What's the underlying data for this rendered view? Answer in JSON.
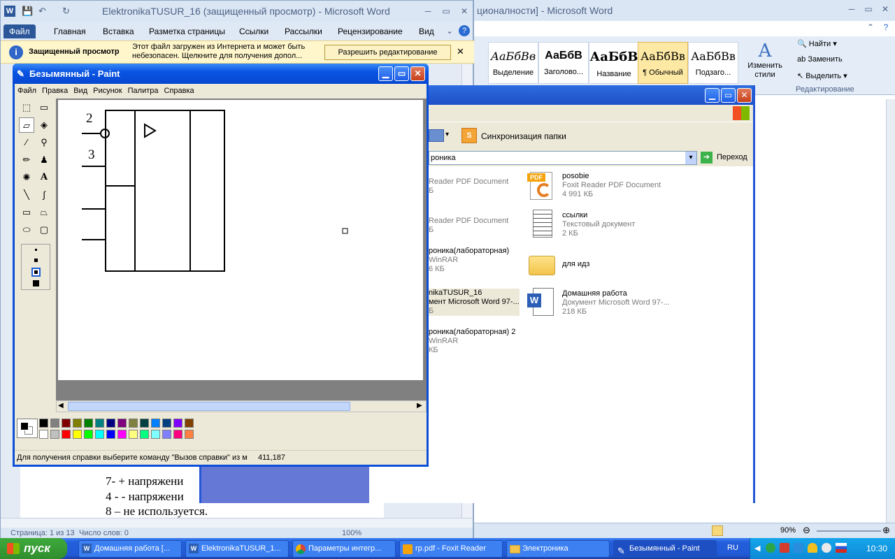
{
  "word_back": {
    "title": "ционалности] - Microsoft Word",
    "styles": [
      {
        "sample": "АаБбВв",
        "name": "Выделение"
      },
      {
        "sample": "АаБбВ",
        "name": "Заголово..."
      },
      {
        "sample": "АаБбВ",
        "name": "Название"
      },
      {
        "sample": "АаБбВв",
        "name": "¶ Обычный"
      },
      {
        "sample": "АаБбВв",
        "name": "Подзаго..."
      }
    ],
    "change_styles": "Изменить стили",
    "find": "Найти",
    "replace": "Заменить",
    "select": "Выделить",
    "editing_group": "Редактирование",
    "zoom": "90%"
  },
  "word_front": {
    "title": "ElektronikaTUSUR_16 (защищенный просмотр) - Microsoft Word",
    "tabs": [
      "Файл",
      "Главная",
      "Вставка",
      "Разметка страницы",
      "Ссылки",
      "Рассылки",
      "Рецензирование",
      "Вид"
    ],
    "protected_label": "Защищенный просмотр",
    "protected_text1": "Этот файл загружен из Интернета и может быть",
    "protected_text2": "небезопасен. Щелкните для получения допол...",
    "enable_editing": "Разрешить редактирование",
    "doc_lines": [
      "7-  + напряжени",
      "4 - - напряжени",
      "8 – не используется."
    ],
    "status_page": "Страница: 1 из 13",
    "status_words": "Число слов: 0",
    "zoom": "100%"
  },
  "explorer": {
    "sync_button": "Синхронизация папки",
    "address": "роника",
    "go_button": "Переход",
    "left_items": [
      {
        "name": "",
        "sub1": "Reader PDF Document",
        "sub2": "Б"
      },
      {
        "name": "",
        "sub1": "Reader PDF Document",
        "sub2": "Б"
      },
      {
        "name": "роника(лабораторная)",
        "sub1": "WinRAR",
        "sub2": "6 КБ"
      },
      {
        "name": "nikaTUSUR_16",
        "sub1": "мент Microsoft Word 97-...",
        "sub2": "Б"
      },
      {
        "name": "роника(лабораторная) 2",
        "sub1": "WinRAR",
        "sub2": "КБ"
      }
    ],
    "right_items": [
      {
        "name": "posobie",
        "sub1": "Foxit Reader PDF Document",
        "sub2": "4 991 КБ",
        "icon": "pdf-icon"
      },
      {
        "name": "ссылки",
        "sub1": "Текстовый документ",
        "sub2": "2 КБ",
        "icon": "text-document-icon"
      },
      {
        "name": "для идз",
        "sub1": "",
        "sub2": "",
        "icon": "folder-icon"
      },
      {
        "name": "Домашняя работа",
        "sub1": "Документ Microsoft Word 97-...",
        "sub2": "218 КБ",
        "icon": "word-document-icon"
      }
    ]
  },
  "paint": {
    "title": "Безымянный - Paint",
    "menu": [
      "Файл",
      "Правка",
      "Вид",
      "Рисунок",
      "Палитра",
      "Справка"
    ],
    "drawing_labels": [
      "2",
      "3"
    ],
    "status": "Для получения справки выберите команду \"Вызов справки\" из м",
    "coords": "411,187",
    "palette_top": [
      "#000000",
      "#808080",
      "#800000",
      "#808000",
      "#008000",
      "#008080",
      "#000080",
      "#800080",
      "#808040",
      "#004040",
      "#0080ff",
      "#004080",
      "#8000ff",
      "#804000"
    ],
    "palette_bottom": [
      "#ffffff",
      "#c0c0c0",
      "#ff0000",
      "#ffff00",
      "#00ff00",
      "#00ffff",
      "#0000ff",
      "#ff00ff",
      "#ffff80",
      "#00ff80",
      "#80ffff",
      "#8080ff",
      "#ff0080",
      "#ff8040"
    ]
  },
  "taskbar": {
    "start": "пуск",
    "tasks": [
      {
        "label": "Домашняя работа [...",
        "icon": "word-icon"
      },
      {
        "label": "ElektronikaTUSUR_1...",
        "icon": "word-icon"
      },
      {
        "label": "Параметры интегр...",
        "icon": "chrome-icon"
      },
      {
        "label": "rp.pdf - Foxit Reader",
        "icon": "foxit-icon"
      },
      {
        "label": "Электроника",
        "icon": "folder-icon"
      },
      {
        "label": "Безымянный - Paint",
        "icon": "paint-icon"
      }
    ],
    "lang": "RU",
    "clock": "10:30"
  }
}
